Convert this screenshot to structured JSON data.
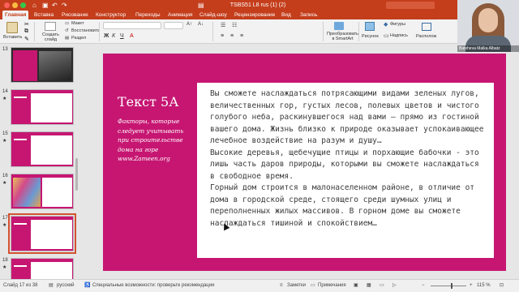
{
  "window": {
    "title": "TSBS51 L8 rus (1) (2)"
  },
  "tabs": [
    {
      "label": "Главная",
      "active": true
    },
    {
      "label": "Вставка"
    },
    {
      "label": "Рисование"
    },
    {
      "label": "Конструктор"
    },
    {
      "label": "Переходы"
    },
    {
      "label": "Анимация"
    },
    {
      "label": "Слайд-шоу"
    },
    {
      "label": "Рецензирование"
    },
    {
      "label": "Вид"
    },
    {
      "label": "Запись"
    }
  ],
  "ribbon": {
    "paste": "Вставить",
    "new_slide": "Создать\nслайд",
    "layout": "Макет",
    "reset": "Восстановить",
    "section": "Раздел",
    "smartart": "Преобразовать\nв SmartArt",
    "picture": "Рисунок",
    "shapes": "Фигуры",
    "textbox": "Надпись",
    "arrange": "Располож"
  },
  "slides_panel": {
    "items": [
      {
        "number": "13",
        "star": "",
        "style": "photo-dark"
      },
      {
        "number": "14",
        "star": "★",
        "style": "text"
      },
      {
        "number": "15",
        "star": "★",
        "style": "text"
      },
      {
        "number": "16",
        "star": "★",
        "style": "photo-colorful"
      },
      {
        "number": "17",
        "star": "★",
        "style": "text-selected"
      },
      {
        "number": "18",
        "star": "★",
        "style": "text"
      }
    ]
  },
  "slide": {
    "title": "Текст 5А",
    "subtitle": "Факторы, которые следует учитывать при строительстве дома на горе www.Zameen.org",
    "body": "Вы сможете наслаждаться потрясающими видами зеленых лугов, величественных гор, густых лесов, полевых цветов и чистого голубого неба, раскинувшегося над вами – прямо из гостиной вашего дома. Жизнь близко к природе оказывает успокаивающее лечебное воздействие на разум и душу…\nВысокие деревья, щебечущие птицы и порхающие бабочки - это лишь часть даров природы, которыми вы сможете наслаждаться в свободное время.\nГорный дом строится в малонаселенном районе, в отличие от дома в городской среде, стоящего среди шумных улиц и переполненных жилых массивов. В горном доме вы сможете наслаждаться тишиной и спокойствием…"
  },
  "webcam": {
    "name": "Batsheva Malka Albatz"
  },
  "status": {
    "slide_info": "Слайд 17 из 38",
    "language": "русский",
    "accessibility": "Специальные возможности: проверьте рекомендации",
    "notes": "Заметки",
    "comments": "Примечания",
    "zoom": "115 %"
  },
  "colors": {
    "accent": "#c43e1c",
    "slide_bg": "#c61672"
  }
}
